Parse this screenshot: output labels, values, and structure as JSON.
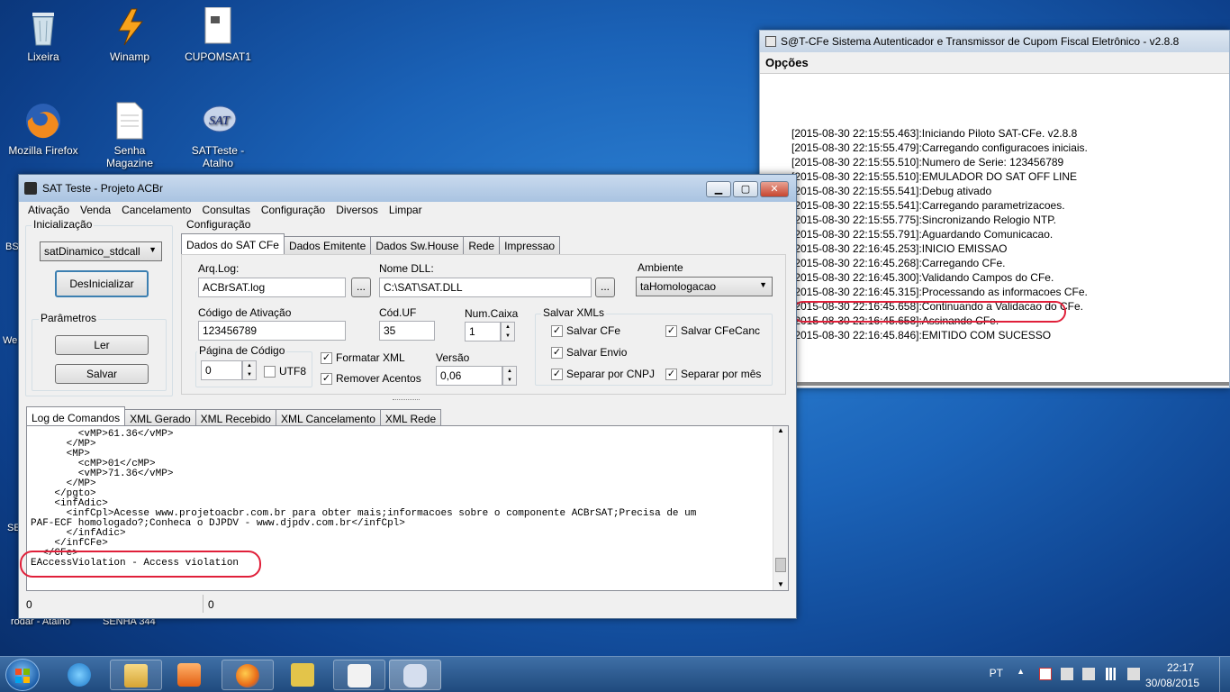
{
  "desktop": {
    "icons": [
      {
        "label": "Lixeira"
      },
      {
        "label": "Winamp"
      },
      {
        "label": "CUPOMSAT1"
      },
      {
        "label": "Mozilla Firefox"
      },
      {
        "label": "Senha Magazine"
      },
      {
        "label": "SATTeste - Atalho"
      }
    ],
    "edge_texts": [
      "BS",
      "We",
      "SE",
      "rodar - Atalho",
      "SENHA 344"
    ]
  },
  "satcfe_window": {
    "title": "S@T-CFe Sistema Autenticador e Transmissor de Cupom Fiscal Eletrônico - v2.8.8",
    "menu": "Opções",
    "log": [
      "[2015-08-30 22:15:55.463]:Iniciando Piloto SAT-CFe. v2.8.8",
      "[2015-08-30 22:15:55.479]:Carregando configuracoes iniciais.",
      "[2015-08-30 22:15:55.510]:Numero de Serie: 123456789",
      "[2015-08-30 22:15:55.510]:EMULADOR DO SAT OFF LINE",
      "[2015-08-30 22:15:55.541]:Debug ativado",
      "[2015-08-30 22:15:55.541]:Carregando parametrizacoes.",
      "[2015-08-30 22:15:55.775]:Sincronizando Relogio NTP.",
      "[2015-08-30 22:15:55.791]:Aguardando Comunicacao.",
      "[2015-08-30 22:16:45.253]:INICIO EMISSAO",
      "[2015-08-30 22:16:45.268]:Carregando CFe.",
      "[2015-08-30 22:16:45.300]:Validando Campos do CFe.",
      "[2015-08-30 22:16:45.315]:Processando as informacoes CFe.",
      "[2015-08-30 22:16:45.658]:Continuando a Validacao do CFe.",
      "[2015-08-30 22:16:45.658]:Assinando CFe.",
      "[2015-08-30 22:16:45.846]:EMITIDO COM SUCESSO"
    ]
  },
  "sat_window": {
    "title": "SAT Teste - Projeto ACBr",
    "controls": {
      "minimize": "▁",
      "maximize": "▢",
      "close": "✕"
    },
    "menu": [
      "Ativação",
      "Venda",
      "Cancelamento",
      "Consultas",
      "Configuração",
      "Diversos",
      "Limpar"
    ],
    "init": {
      "group_label": "Inicialização",
      "model_value": "satDinamico_stdcall",
      "desinit_button": "DesInicializar",
      "params_label": "Parâmetros",
      "read_button": "Ler",
      "save_button": "Salvar"
    },
    "config": {
      "group_label": "Configuração",
      "tabs": [
        "Dados do SAT CFe",
        "Dados Emitente",
        "Dados Sw.House",
        "Rede",
        "Impressao"
      ],
      "arq_log_label": "Arq.Log:",
      "arq_log_value": "ACBrSAT.log",
      "dll_label": "Nome DLL:",
      "dll_value": "C:\\SAT\\SAT.DLL",
      "browse": "...",
      "ambiente_label": "Ambiente",
      "ambiente_value": "taHomologacao",
      "codigo_ativacao_label": "Código de Ativação",
      "codigo_ativacao_value": "123456789",
      "cod_uf_label": "Cód.UF",
      "cod_uf_value": "35",
      "num_caixa_label": "Num.Caixa",
      "num_caixa_value": "1",
      "pagina_codigo_label": "Página de Código",
      "pagina_codigo_value": "0",
      "utf8_label": "UTF8",
      "formatar_xml_label": "Formatar XML",
      "remover_acentos_label": "Remover Acentos",
      "versao_label": "Versão",
      "versao_value": "0,06",
      "salvar_xmls_label": "Salvar XMLs",
      "salvar_cfe": "Salvar CFe",
      "salvar_cfecanc": "Salvar CFeCanc",
      "salvar_envio": "Salvar Envio",
      "separar_cnpj": "Separar por CNPJ",
      "separar_mes": "Separar por mês"
    },
    "log_tabs": [
      "Log de Comandos",
      "XML Gerado",
      "XML Recebido",
      "XML Cancelamento",
      "XML Rede"
    ],
    "log_code": [
      "        <vMP>61.36</vMP>",
      "      </MP>",
      "      <MP>",
      "        <cMP>01</cMP>",
      "        <vMP>71.36</vMP>",
      "      </MP>",
      "    </pgto>",
      "    <infAdic>",
      "      <infCpl>Acesse www.projetoacbr.com.br para obter mais;informacoes sobre o componente ACBrSAT;Precisa de um",
      "PAF-ECF homologado?;Conheca o DJPDV - www.djpdv.com.br</infCpl>",
      "      </infAdic>",
      "    </infCFe>",
      "  </CFe>",
      "EAccessViolation - Access violation"
    ],
    "status_left": "0",
    "status_right": "0"
  },
  "taskbar": {
    "tray_lang": "PT",
    "time": "22:17",
    "date": "30/08/2015"
  }
}
